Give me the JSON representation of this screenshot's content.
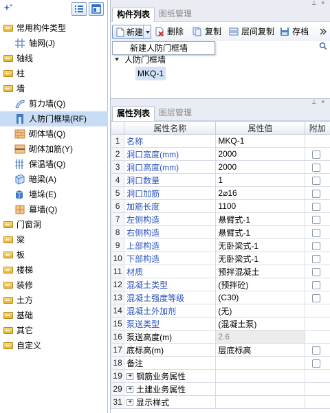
{
  "left_panel": {
    "tree": [
      {
        "label": "常用构件类型",
        "icon": "folder-icon",
        "level": 0
      },
      {
        "label": "轴网(J)",
        "icon": "grid-icon",
        "level": 1
      },
      {
        "label": "轴线",
        "icon": "folder-icon",
        "level": 0
      },
      {
        "label": "柱",
        "icon": "folder-icon",
        "level": 0
      },
      {
        "label": "墙",
        "icon": "folder-icon",
        "level": 0
      },
      {
        "label": "剪力墙(Q)",
        "icon": "shear-wall-icon",
        "level": 1
      },
      {
        "label": "人防门框墙(RF)",
        "icon": "door-frame-icon",
        "level": 1,
        "selected": true
      },
      {
        "label": "砌体墙(Q)",
        "icon": "masonry-wall-icon",
        "level": 1
      },
      {
        "label": "砌体加筋(Y)",
        "icon": "masonry-rebar-icon",
        "level": 1
      },
      {
        "label": "保温墙(Q)",
        "icon": "insulation-wall-icon",
        "level": 1
      },
      {
        "label": "暗梁(A)",
        "icon": "hidden-beam-icon",
        "level": 1
      },
      {
        "label": "墙垛(E)",
        "icon": "wall-pier-icon",
        "level": 1
      },
      {
        "label": "幕墙(Q)",
        "icon": "curtain-wall-icon",
        "level": 1
      },
      {
        "label": "门窗洞",
        "icon": "folder-icon",
        "level": 0
      },
      {
        "label": "梁",
        "icon": "folder-icon",
        "level": 0
      },
      {
        "label": "板",
        "icon": "folder-icon",
        "level": 0
      },
      {
        "label": "楼梯",
        "icon": "folder-icon",
        "level": 0
      },
      {
        "label": "装修",
        "icon": "folder-icon",
        "level": 0
      },
      {
        "label": "土方",
        "icon": "folder-icon",
        "level": 0
      },
      {
        "label": "基础",
        "icon": "folder-icon",
        "level": 0
      },
      {
        "label": "其它",
        "icon": "folder-icon",
        "level": 0
      },
      {
        "label": "自定义",
        "icon": "folder-icon",
        "level": 0
      }
    ]
  },
  "component_panel": {
    "tabs": [
      "构件列表",
      "图纸管理"
    ],
    "toolbar": {
      "new": "新建",
      "delete": "删除",
      "copy": "复制",
      "floor_copy": "层间复制",
      "archive": "存档"
    },
    "dropdown_item": "新建人防门框墙",
    "tree_parent": "人防门框墙",
    "tree_item": "MKQ-1"
  },
  "property_panel": {
    "tabs": [
      "属性列表",
      "图层管理"
    ],
    "headers": [
      "属性名称",
      "属性值",
      "附加"
    ],
    "rows": [
      {
        "num": "1",
        "name": "名称",
        "value": "MKQ-1",
        "blue": true,
        "checkbox": false
      },
      {
        "num": "2",
        "name": "洞口宽度(mm)",
        "value": "2000",
        "blue": true,
        "checkbox": true
      },
      {
        "num": "3",
        "name": "洞口高度(mm)",
        "value": "2000",
        "blue": true,
        "checkbox": true
      },
      {
        "num": "4",
        "name": "洞口数量",
        "value": "1",
        "blue": true,
        "checkbox": true
      },
      {
        "num": "5",
        "name": "洞口加筋",
        "value": "2⌀16",
        "blue": true,
        "checkbox": true
      },
      {
        "num": "6",
        "name": "加筋长度",
        "value": "1100",
        "blue": true,
        "checkbox": true
      },
      {
        "num": "7",
        "name": "左侧构造",
        "value": "悬臂式-1",
        "blue": true,
        "checkbox": true
      },
      {
        "num": "8",
        "name": "右侧构造",
        "value": "悬臂式-1",
        "blue": true,
        "checkbox": true
      },
      {
        "num": "9",
        "name": "上部构造",
        "value": "无卧梁式-1",
        "blue": true,
        "checkbox": true
      },
      {
        "num": "10",
        "name": "下部构造",
        "value": "无卧梁式-1",
        "blue": true,
        "checkbox": true
      },
      {
        "num": "11",
        "name": "材质",
        "value": "预拌混凝土",
        "blue": true,
        "checkbox": true
      },
      {
        "num": "12",
        "name": "混凝土类型",
        "value": "(预拌砼)",
        "blue": true,
        "checkbox": true
      },
      {
        "num": "13",
        "name": "混凝土强度等级",
        "value": "(C30)",
        "blue": true,
        "checkbox": true
      },
      {
        "num": "14",
        "name": "混凝土外加剂",
        "value": "(无)",
        "blue": true,
        "checkbox": false
      },
      {
        "num": "15",
        "name": "泵送类型",
        "value": "(混凝土泵)",
        "blue": true,
        "checkbox": false
      },
      {
        "num": "16",
        "name": "泵送高度(m)",
        "value": "2.6",
        "blue": false,
        "checkbox": false,
        "grey": true
      },
      {
        "num": "17",
        "name": "底标高(m)",
        "value": "层底标高",
        "blue": false,
        "checkbox": true
      },
      {
        "num": "18",
        "name": "备注",
        "value": "",
        "blue": false,
        "checkbox": true
      },
      {
        "num": "19",
        "name": "钢筋业务属性",
        "value": "",
        "blue": false,
        "checkbox": false,
        "group": true
      },
      {
        "num": "29",
        "name": "土建业务属性",
        "value": "",
        "blue": false,
        "checkbox": false,
        "group": true
      },
      {
        "num": "31",
        "name": "显示样式",
        "value": "",
        "blue": false,
        "checkbox": false,
        "group": true
      }
    ]
  },
  "colors": {
    "selection": "#c9dcf5",
    "link_blue": "#2a52be"
  }
}
